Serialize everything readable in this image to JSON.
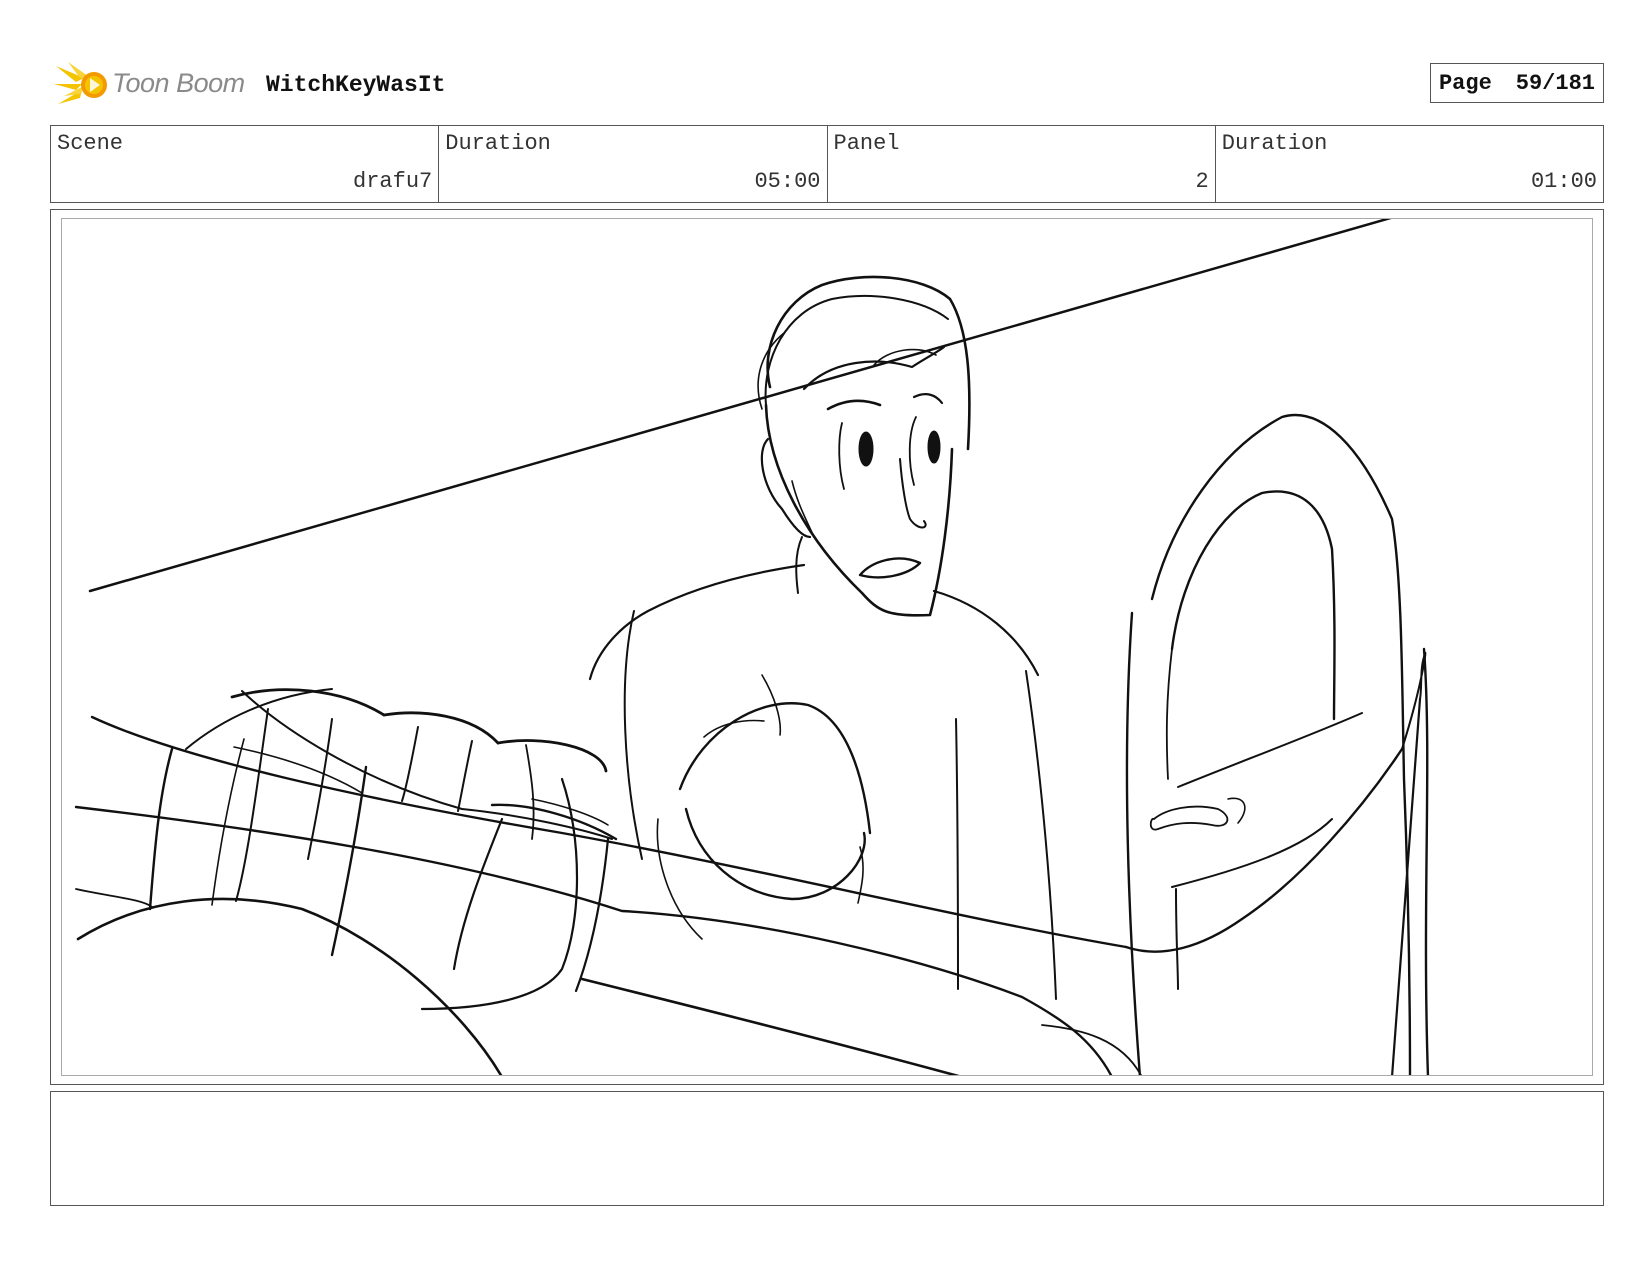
{
  "header": {
    "brand": "Toon Boom",
    "project_title": "WitchKeyWasIt",
    "page_label": "Page",
    "page_number": "59/181"
  },
  "info": {
    "scene_label": "Scene",
    "scene_value": "drafu7",
    "scene_duration_label": "Duration",
    "scene_duration_value": "05:00",
    "panel_label": "Panel",
    "panel_value": "2",
    "panel_duration_label": "Duration",
    "panel_duration_value": "01:00"
  },
  "icons": {
    "logo": "toon-boom-star-icon"
  },
  "colors": {
    "logo_yellow": "#f5c400",
    "logo_orange": "#f39a00",
    "logo_text": "#8a8a8a",
    "border": "#555555"
  },
  "notes": {
    "text": ""
  }
}
